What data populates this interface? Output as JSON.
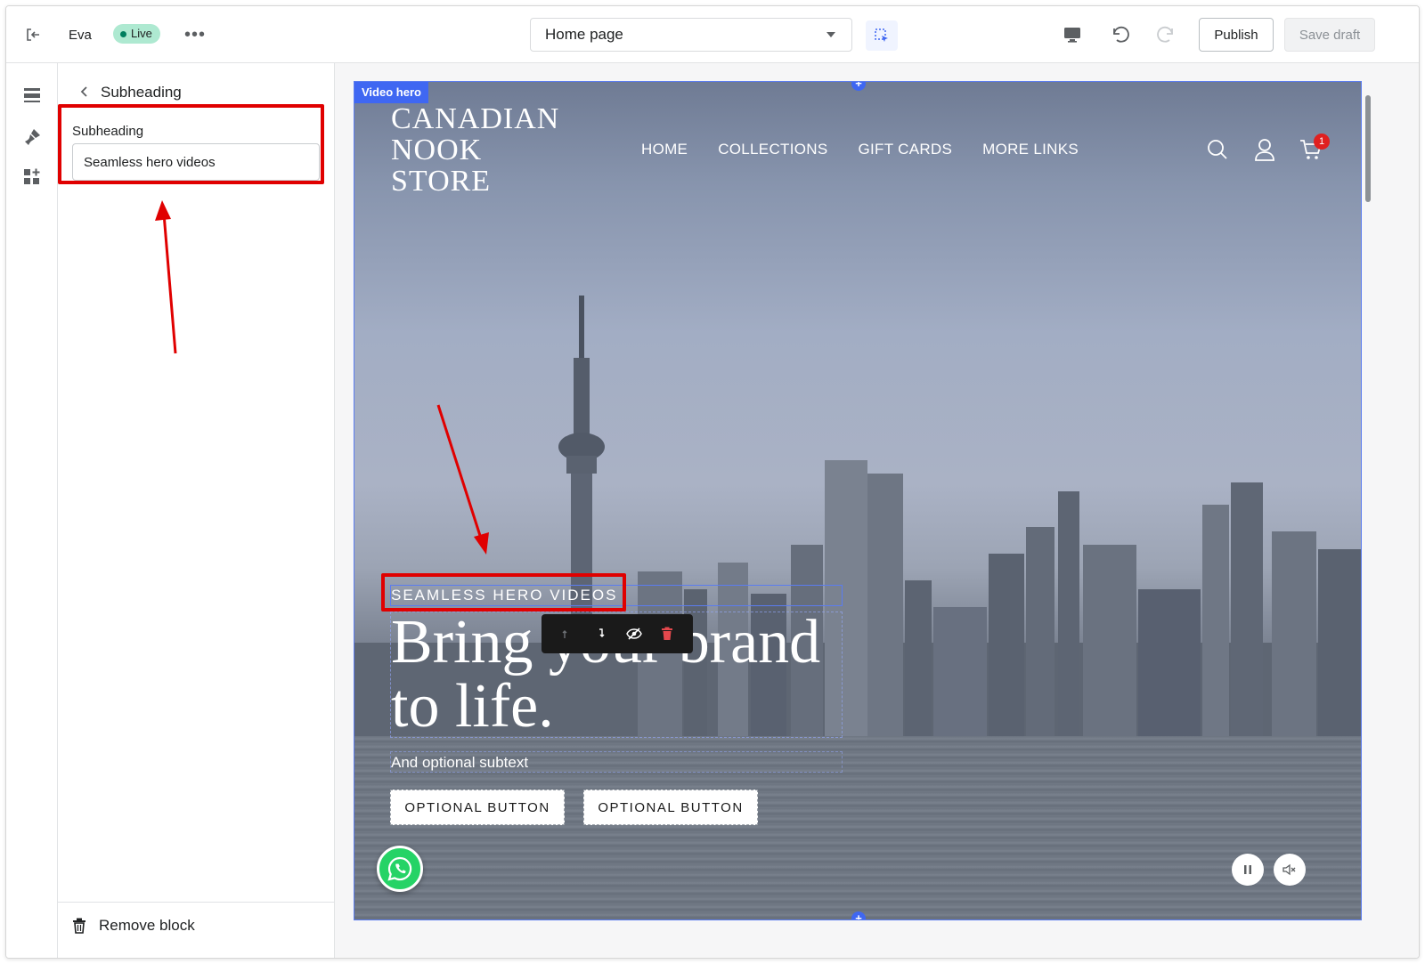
{
  "topbar": {
    "theme_name": "Eva",
    "status_badge": "Live",
    "more_label": "•••",
    "page_selector": "Home page",
    "publish_label": "Publish",
    "save_draft_label": "Save draft"
  },
  "panel": {
    "title": "Subheading",
    "field_label": "Subheading",
    "field_value": "Seamless hero videos",
    "remove_label": "Remove block"
  },
  "preview": {
    "section_tag": "Video hero",
    "logo": "CANADIAN\nNOOK\nSTORE",
    "nav": [
      "HOME",
      "COLLECTIONS",
      "GIFT CARDS",
      "MORE LINKS"
    ],
    "cart_count": "1",
    "subheading": "SEAMLESS HERO VIDEOS",
    "heading": "Bring your brand to life.",
    "subtext": "And optional subtext",
    "button_1": "OPTIONAL BUTTON",
    "button_2": "OPTIONAL BUTTON"
  },
  "colors": {
    "accent": "#3f67f2",
    "live_badge": "#aee9d1",
    "annotation_red": "#e00000",
    "whatsapp_green": "#25d366"
  },
  "icons": {
    "exit": "exit-icon",
    "inspector": "inspector-icon",
    "desktop": "desktop-icon",
    "undo": "undo-icon",
    "redo": "redo-icon",
    "sections": "sections-icon",
    "theme_settings": "paintbrush-icon",
    "apps": "apps-icon",
    "back": "chevron-left-icon",
    "remove": "trash-icon",
    "search": "search-icon",
    "account": "user-icon",
    "cart": "cart-icon",
    "whatsapp": "whatsapp-icon",
    "pause": "pause-icon",
    "mute": "mute-icon"
  }
}
